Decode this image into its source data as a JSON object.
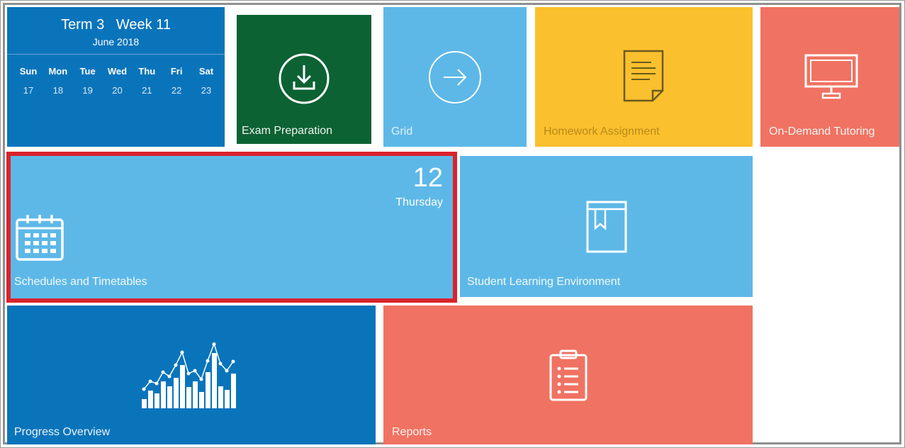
{
  "colors": {
    "darkBlue": "#0a74bb",
    "lightBlue": "#5db8e8",
    "green": "#0d6233",
    "yellow": "#fbc02d",
    "coral": "#f07262",
    "highlight": "#d9232b"
  },
  "calendar": {
    "term_week": "Term 3   Week 11",
    "month": "June 2018",
    "days": [
      "Sun",
      "Mon",
      "Tue",
      "Wed",
      "Thu",
      "Fri",
      "Sat"
    ],
    "dates": [
      "17",
      "18",
      "19",
      "20",
      "21",
      "22",
      "23"
    ]
  },
  "tiles": {
    "exam": {
      "label": "Exam Preparation",
      "icon": "download-circle-icon"
    },
    "grid": {
      "label": "Grid",
      "icon": "arrow-right-circle-icon"
    },
    "homework": {
      "label": "Homework Assignment",
      "icon": "document-icon"
    },
    "tutoring": {
      "label": "On-Demand Tutoring",
      "icon": "monitor-icon"
    },
    "schedules": {
      "label": "Schedules and Timetables",
      "day_number": "12",
      "day_name": "Thursday",
      "icon": "calendar-icon"
    },
    "sle": {
      "label": "Student Learning Environment",
      "icon": "book-icon"
    },
    "progress": {
      "label": "Progress Overview",
      "icon": "bar-chart-icon"
    },
    "reports": {
      "label": "Reports",
      "icon": "clipboard-icon"
    }
  }
}
